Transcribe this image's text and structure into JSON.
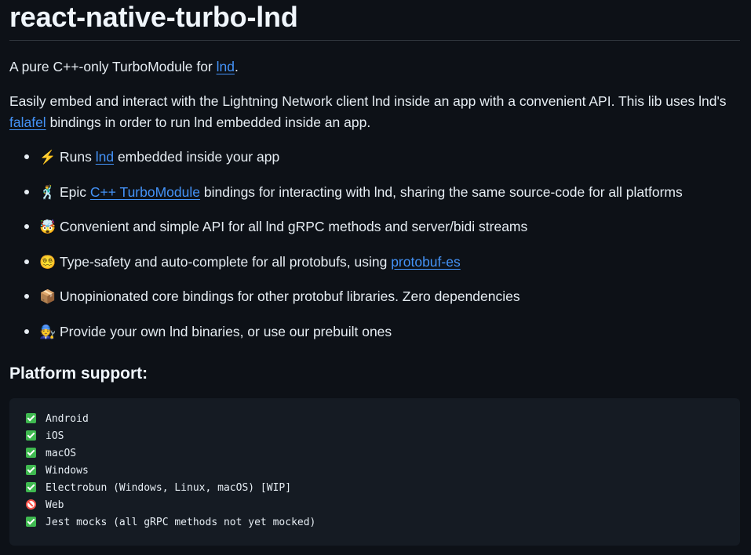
{
  "title": "react-native-turbo-lnd",
  "intro": {
    "prefix": "A pure C++-only TurboModule for ",
    "link": "lnd",
    "suffix": "."
  },
  "description": {
    "text1": "Easily embed and interact with the Lightning Network client lnd inside an app with a convenient API. This lib uses lnd's ",
    "link": "falafel",
    "text2": " bindings in order to run lnd embedded inside an app."
  },
  "features": [
    {
      "emoji": "⚡",
      "icon": "lightning-icon",
      "before": "Runs ",
      "link": "lnd",
      "after": " embedded inside your app"
    },
    {
      "emoji": "🕺",
      "icon": "dancer-icon",
      "before": "Epic ",
      "link": "C++ TurboModule",
      "after": " bindings for interacting with lnd, sharing the same source-code for all platforms"
    },
    {
      "emoji": "🤯",
      "icon": "mind-blown-icon",
      "before": "Convenient and simple API for all lnd gRPC methods and server/bidi streams",
      "link": "",
      "after": ""
    },
    {
      "emoji": "😵‍💫",
      "icon": "dizzy-face-icon",
      "before": "Type-safety and auto-complete for all protobufs, using ",
      "link": "protobuf-es",
      "after": ""
    },
    {
      "emoji": "📦",
      "icon": "package-icon",
      "before": "Unopinionated core bindings for other protobuf libraries. Zero dependencies",
      "link": "",
      "after": ""
    },
    {
      "emoji": "🧑‍🔧",
      "icon": "mechanic-icon",
      "before": "Provide your own lnd binaries, or use our prebuilt ones",
      "link": "",
      "after": ""
    }
  ],
  "platform_heading": "Platform support:",
  "platforms": [
    {
      "status": "check",
      "icon": "check-mark-icon",
      "text": "Android"
    },
    {
      "status": "check",
      "icon": "check-mark-icon",
      "text": "iOS"
    },
    {
      "status": "check",
      "icon": "check-mark-icon",
      "text": "macOS"
    },
    {
      "status": "check",
      "icon": "check-mark-icon",
      "text": "Windows"
    },
    {
      "status": "check",
      "icon": "check-mark-icon",
      "text": "Electrobun (Windows, Linux, macOS) [WIP]"
    },
    {
      "status": "forbid",
      "icon": "no-entry-icon",
      "text": "Web"
    },
    {
      "status": "check",
      "icon": "check-mark-icon",
      "text": "Jest mocks (all gRPC methods not yet mocked)"
    }
  ],
  "colors": {
    "background": "#0d1117",
    "text": "#e6edf3",
    "link": "#4493f8",
    "code_bg": "#151b23",
    "check": "#3fb950",
    "forbid": "#f85149"
  }
}
